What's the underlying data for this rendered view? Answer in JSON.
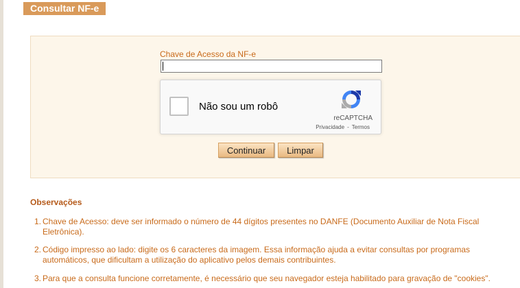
{
  "header": {
    "title": "Consultar NF-e"
  },
  "form": {
    "field_label": "Chave de Acesso da NF-e",
    "access_key_value": "",
    "continue_label": "Continuar",
    "clear_label": "Limpar"
  },
  "recaptcha": {
    "checkbox_label": "Não sou um robô",
    "brand": "reCAPTCHA",
    "privacy": "Privacidade",
    "separator": "-",
    "terms": "Termos"
  },
  "observations": {
    "title": "Observações",
    "items": [
      {
        "num": "1.",
        "line1": "Chave de Acesso: deve ser informado o número de 44 dígitos presentes no DANFE (Documento Auxiliar de Nota Fiscal",
        "line2": "Eletrônica)."
      },
      {
        "num": "2.",
        "line1": "Código impresso ao lado: digite os 6 caracteres da imagem. Essa informação ajuda a evitar consultas por programas",
        "line2": "automáticos, que dificultam a utilização do aplicativo pelos demais contribuintes."
      },
      {
        "num": "3.",
        "line1": "Para que a consulta funcione corretamente, é necessário que seu navegador esteja habilitado para gravação de \"cookies\".",
        "line2": ""
      }
    ]
  },
  "colors": {
    "accent": "#d99a5a",
    "text_orange": "#c86a1a",
    "panel_bg": "#fdf6ea"
  }
}
